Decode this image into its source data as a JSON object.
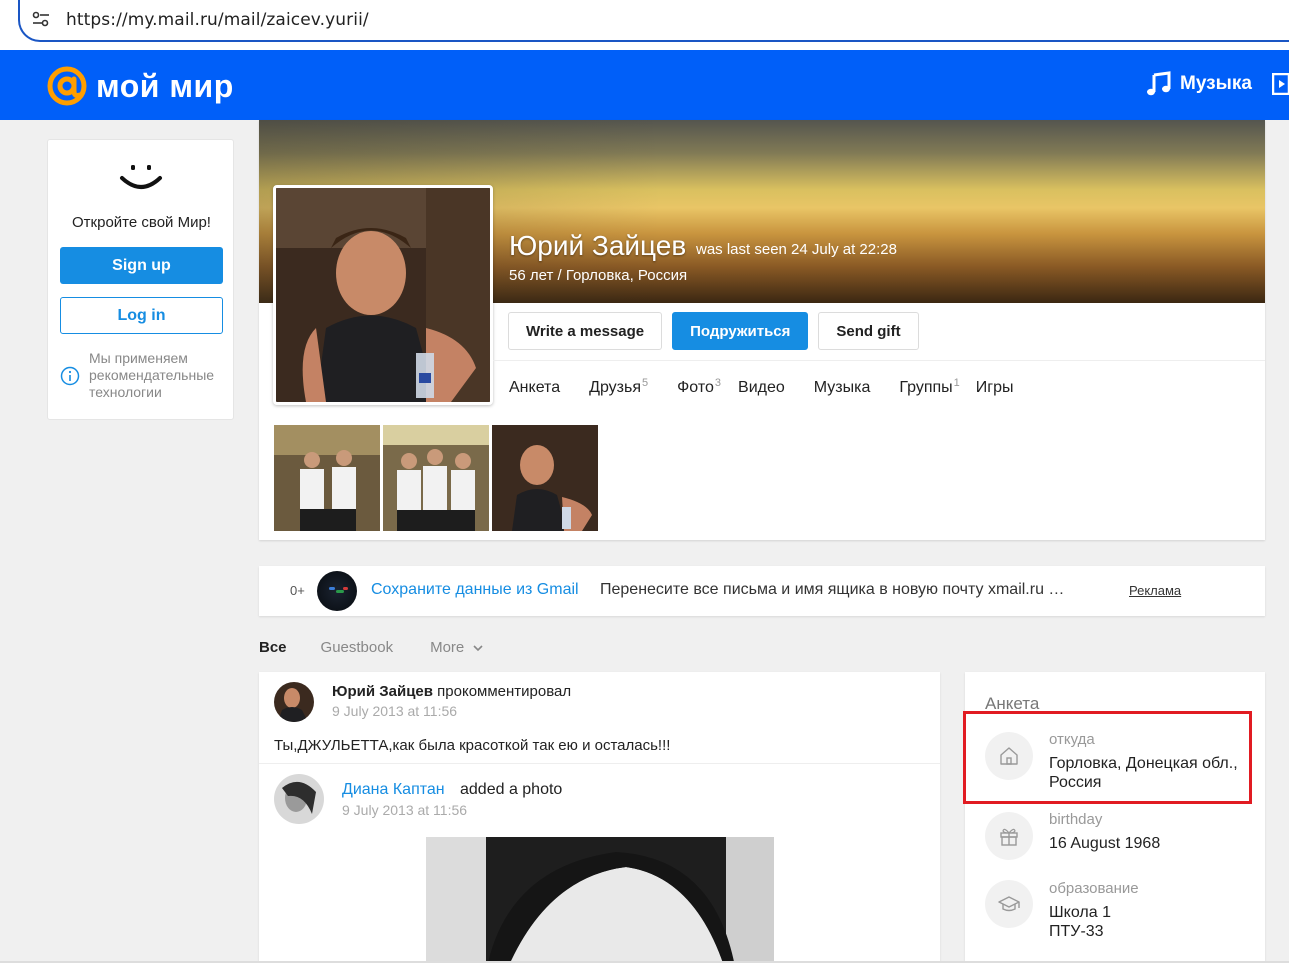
{
  "browser": {
    "url": "https://my.mail.ru/mail/zaicev.yurii/"
  },
  "header": {
    "logo_text": "мой мир",
    "music_label": "Музыка",
    "colors": {
      "header_bg": "#005ff9",
      "logo_accent": "#ff9e00"
    }
  },
  "left_card": {
    "headline": "Откройте свой Мир!",
    "signup_label": "Sign up",
    "login_label": "Log in",
    "recommend_text": "Мы применяем рекомендательные технологии"
  },
  "profile": {
    "name": "Юрий Зайцев",
    "last_seen": "was last seen 24 July at 22:28",
    "subinfo": "56 лет / Горловка, Россия",
    "actions": {
      "message": "Write a message",
      "befriend": "Подружиться",
      "gift": "Send gift"
    },
    "nav": [
      {
        "label": "Анкета",
        "count": ""
      },
      {
        "label": "Друзья",
        "count": "5"
      },
      {
        "label": "Фото",
        "count": "3"
      },
      {
        "label": "Видео",
        "count": ""
      },
      {
        "label": "Музыка",
        "count": ""
      },
      {
        "label": "Группы",
        "count": "1"
      },
      {
        "label": "Игры",
        "count": ""
      }
    ]
  },
  "ad": {
    "age": "0+",
    "title": "Сохраните данные из Gmail",
    "description": "Перенесите все письма и имя ящика в новую почту xmail.ru …",
    "label": "Реклама"
  },
  "feed_tabs": {
    "all": "Все",
    "guestbook": "Guestbook",
    "more": "More"
  },
  "feed": {
    "post1": {
      "author": "Юрий Зайцев",
      "action": "прокомментировал",
      "date": "9 July 2013 at 11:56",
      "text": "Ты,ДЖУЛЬЕТТА,как была красоткой так ею и осталась!!!"
    },
    "post2": {
      "author": "Диана Каптан",
      "action": "added a photo",
      "date": "9 July 2013 at 11:56"
    }
  },
  "anketa": {
    "title": "Анкета",
    "from_label": "откуда",
    "from_value": "Горловка, Донецкая обл., Россия",
    "birthday_label": "birthday",
    "birthday_value": "16 August 1968",
    "education_label": "образование",
    "education_value_1": "Школа 1",
    "education_value_2": "ПТУ-33"
  }
}
